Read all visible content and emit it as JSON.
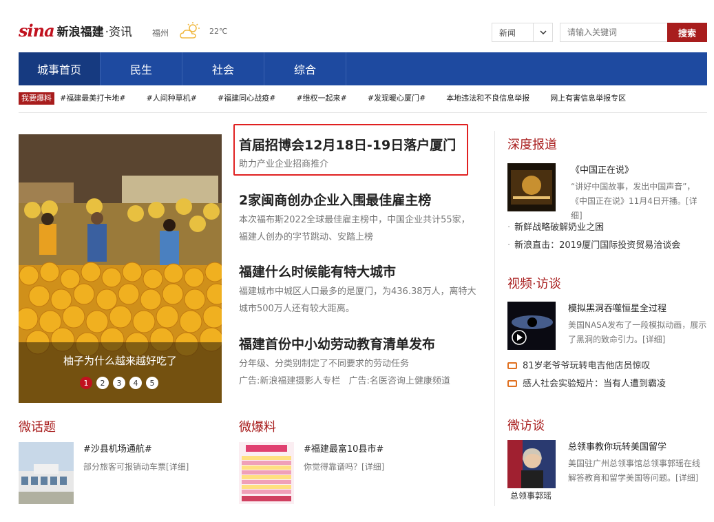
{
  "brand": {
    "logo": "sina",
    "name": "新浪福建",
    "section": "·资讯"
  },
  "weather": {
    "city": "福州",
    "temp": "22℃",
    "icon": "partly-cloudy-icon"
  },
  "search": {
    "category": "新闻",
    "placeholder": "请输入关键词",
    "button": "搜索"
  },
  "nav": [
    "城事首页",
    "民生",
    "社会",
    "综合"
  ],
  "tags": {
    "label": "我要爆料",
    "items": [
      "#福建最美打卡地#",
      "#人间种草机#",
      "#福建同心战疫#",
      "#维权一起来#",
      "#发现暖心厦门#"
    ],
    "links": [
      "本地违法和不良信息举报",
      "网上有害信息举报专区"
    ]
  },
  "slider": {
    "caption": "柚子为什么越来越好吃了",
    "pages": [
      "1",
      "2",
      "3",
      "4",
      "5"
    ],
    "active": 1
  },
  "news": [
    {
      "title": "首届招博会12月18日-19日落户厦门",
      "desc": "助力产业企业招商推介"
    },
    {
      "title": "2家闽商创办企业入围最佳雇主榜",
      "desc": "本次福布斯2022全球最佳雇主榜中，中国企业共计55家，福建人创办的字节跳动、安踏上榜"
    },
    {
      "title": "福建什么时候能有特大城市",
      "desc": "福建城市中城区人口最多的是厦门，为436.38万人，离特大城市500万人还有较大距离。"
    },
    {
      "title": "福建首份中小幼劳动教育清单发布",
      "desc": "分年级、分类别制定了不同要求的劳动任务",
      "ads": [
        "广告:新浪福建摄影人专栏",
        "广告:名医咨询上健康频道"
      ]
    }
  ],
  "depth": {
    "title": "深度报道",
    "head": "《中国正在说》",
    "desc1": "“讲好中国故事，发出中国声音”，",
    "desc2": "《中国正在说》11月4日开播。[详细]",
    "list": [
      "新鲜战略破解奶业之困",
      "新浪直击：2019厦门国际投资贸易洽谈会"
    ]
  },
  "video": {
    "title": "视频·访谈",
    "head": "模拟黑洞吞噬恒星全过程",
    "desc1": "美国NASA发布了一段模拟动画，展示",
    "desc2": "了黑洞的致命引力。[详细]",
    "list": [
      "81岁老爷爷玩转电吉他店员惊叹",
      "感人社会实验短片：当有人遭到霸凌"
    ]
  },
  "interview": {
    "title": "微访谈",
    "head": "总领事教你玩转美国留学",
    "desc1": "美国驻广州总领事馆总领事郭瑶在线",
    "desc2": "解答教育和留学美国等问题。[详细]",
    "photo_caption": "总领事郭瑶"
  },
  "topic": {
    "title": "微话题",
    "head": "#沙县机场通航#",
    "desc": "部分旅客可报销动车票[详细]"
  },
  "report": {
    "title": "微爆料",
    "head": "#福建最富10县市#",
    "desc": "你觉得靠谱吗？[详细]"
  },
  "colors": {
    "brand_red": "#a81d1d",
    "nav_blue": "#1e4aa0",
    "highlight": "#e02020"
  }
}
